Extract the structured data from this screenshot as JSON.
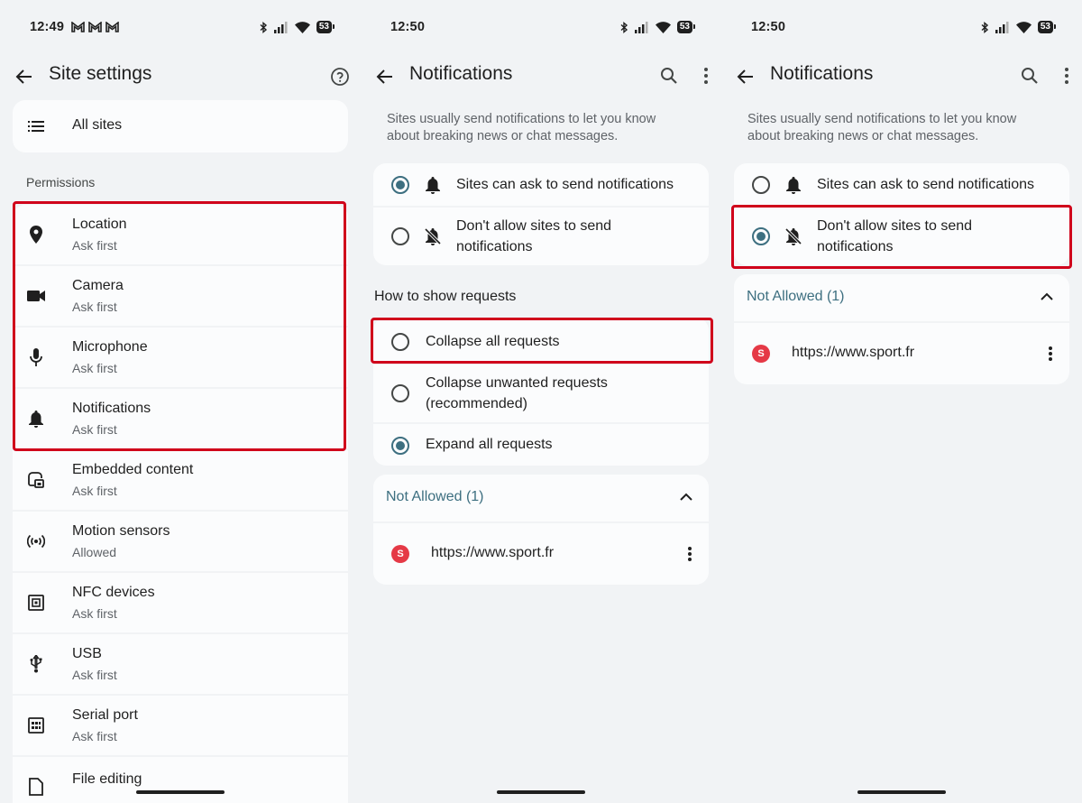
{
  "colors": {
    "accent": "#3d6f80",
    "highlight": "#d0021b",
    "site_badge": "#e53946"
  },
  "panel1": {
    "status": {
      "time": "12:49",
      "battery": "53"
    },
    "title": "Site settings",
    "all_sites": "All sites",
    "permissions_header": "Permissions",
    "items": [
      {
        "label": "Location",
        "sub": "Ask first",
        "icon": "location-pin-icon"
      },
      {
        "label": "Camera",
        "sub": "Ask first",
        "icon": "camera-icon"
      },
      {
        "label": "Microphone",
        "sub": "Ask first",
        "icon": "microphone-icon"
      },
      {
        "label": "Notifications",
        "sub": "Ask first",
        "icon": "bell-icon"
      },
      {
        "label": "Embedded content",
        "sub": "Ask first",
        "icon": "embedded-content-icon"
      },
      {
        "label": "Motion sensors",
        "sub": "Allowed",
        "icon": "motion-sensors-icon"
      },
      {
        "label": "NFC devices",
        "sub": "Ask first",
        "icon": "nfc-icon"
      },
      {
        "label": "USB",
        "sub": "Ask first",
        "icon": "usb-icon"
      },
      {
        "label": "Serial port",
        "sub": "Ask first",
        "icon": "serial-port-icon"
      },
      {
        "label": "File editing",
        "sub": "",
        "icon": "file-editing-icon"
      }
    ]
  },
  "panel2": {
    "status": {
      "time": "12:50",
      "battery": "53"
    },
    "title": "Notifications",
    "description": "Sites usually send notifications to let you know about breaking news or chat messages.",
    "options": [
      {
        "label": "Sites can ask to send notifications",
        "selected": true
      },
      {
        "label": "Don't allow sites to send notifications",
        "selected": false
      }
    ],
    "requests_header": "How to show requests",
    "request_options": [
      {
        "label": "Collapse all requests",
        "selected": false
      },
      {
        "label": "Collapse unwanted requests (recommended)",
        "selected": false
      },
      {
        "label": "Expand all requests",
        "selected": true
      }
    ],
    "not_allowed_header": "Not Allowed (1)",
    "site": {
      "badge": "S",
      "url": "https://www.sport.fr"
    }
  },
  "panel3": {
    "status": {
      "time": "12:50",
      "battery": "53"
    },
    "title": "Notifications",
    "description": "Sites usually send notifications to let you know about breaking news or chat messages.",
    "options": [
      {
        "label": "Sites can ask to send notifications",
        "selected": false
      },
      {
        "label": "Don't allow sites to send notifications",
        "selected": true
      }
    ],
    "not_allowed_header": "Not Allowed (1)",
    "site": {
      "badge": "S",
      "url": "https://www.sport.fr"
    }
  }
}
